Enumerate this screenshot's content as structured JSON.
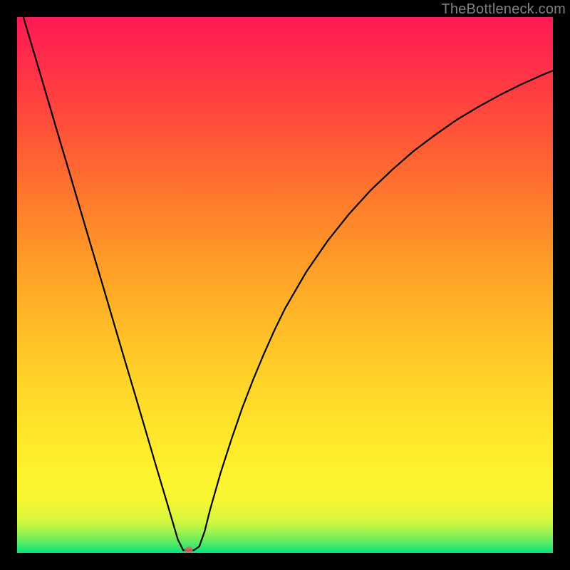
{
  "watermark": "TheBottleneck.com",
  "chart_data": {
    "type": "line",
    "title": "",
    "xlabel": "",
    "ylabel": "",
    "xlim": [
      0,
      100
    ],
    "ylim": [
      0,
      100
    ],
    "grid": false,
    "legend": false,
    "series": [
      {
        "name": "curve",
        "x": [
          0,
          2,
          4,
          6,
          8,
          10,
          12,
          14,
          16,
          18,
          20,
          22,
          24,
          26,
          28,
          30,
          31,
          32,
          33,
          34,
          35,
          36,
          38,
          40,
          42,
          44,
          46,
          48,
          50,
          54,
          58,
          62,
          66,
          70,
          74,
          78,
          82,
          86,
          90,
          94,
          98,
          100
        ],
        "y": [
          104,
          97.2,
          90.5,
          83.7,
          76.9,
          70.2,
          63.4,
          56.6,
          49.9,
          43.1,
          36.3,
          29.6,
          22.8,
          16.0,
          9.3,
          2.5,
          0.5,
          0.5,
          0.5,
          1.2,
          4.0,
          8.0,
          15.0,
          21.2,
          27.0,
          32.2,
          37.0,
          41.5,
          45.6,
          52.5,
          58.3,
          63.3,
          67.7,
          71.5,
          75.0,
          78.0,
          80.8,
          83.2,
          85.4,
          87.4,
          89.2,
          90.0
        ]
      }
    ],
    "minimum_marker": {
      "x": 32,
      "y": 0.5
    },
    "gradient_bands": [
      {
        "y": 0,
        "color": "#00e57c"
      },
      {
        "y": 2,
        "color": "#5dec62"
      },
      {
        "y": 4,
        "color": "#a3f24e"
      },
      {
        "y": 6,
        "color": "#d8f63e"
      },
      {
        "y": 10,
        "color": "#f7f733"
      },
      {
        "y": 15,
        "color": "#fff22e"
      },
      {
        "y": 25,
        "color": "#ffe22a"
      },
      {
        "y": 35,
        "color": "#ffcd28"
      },
      {
        "y": 45,
        "color": "#ffb527"
      },
      {
        "y": 55,
        "color": "#ff9a28"
      },
      {
        "y": 65,
        "color": "#ff7d2c"
      },
      {
        "y": 75,
        "color": "#ff5e34"
      },
      {
        "y": 85,
        "color": "#ff4040"
      },
      {
        "y": 95,
        "color": "#ff254e"
      },
      {
        "y": 100,
        "color": "#ff1a55"
      }
    ]
  }
}
